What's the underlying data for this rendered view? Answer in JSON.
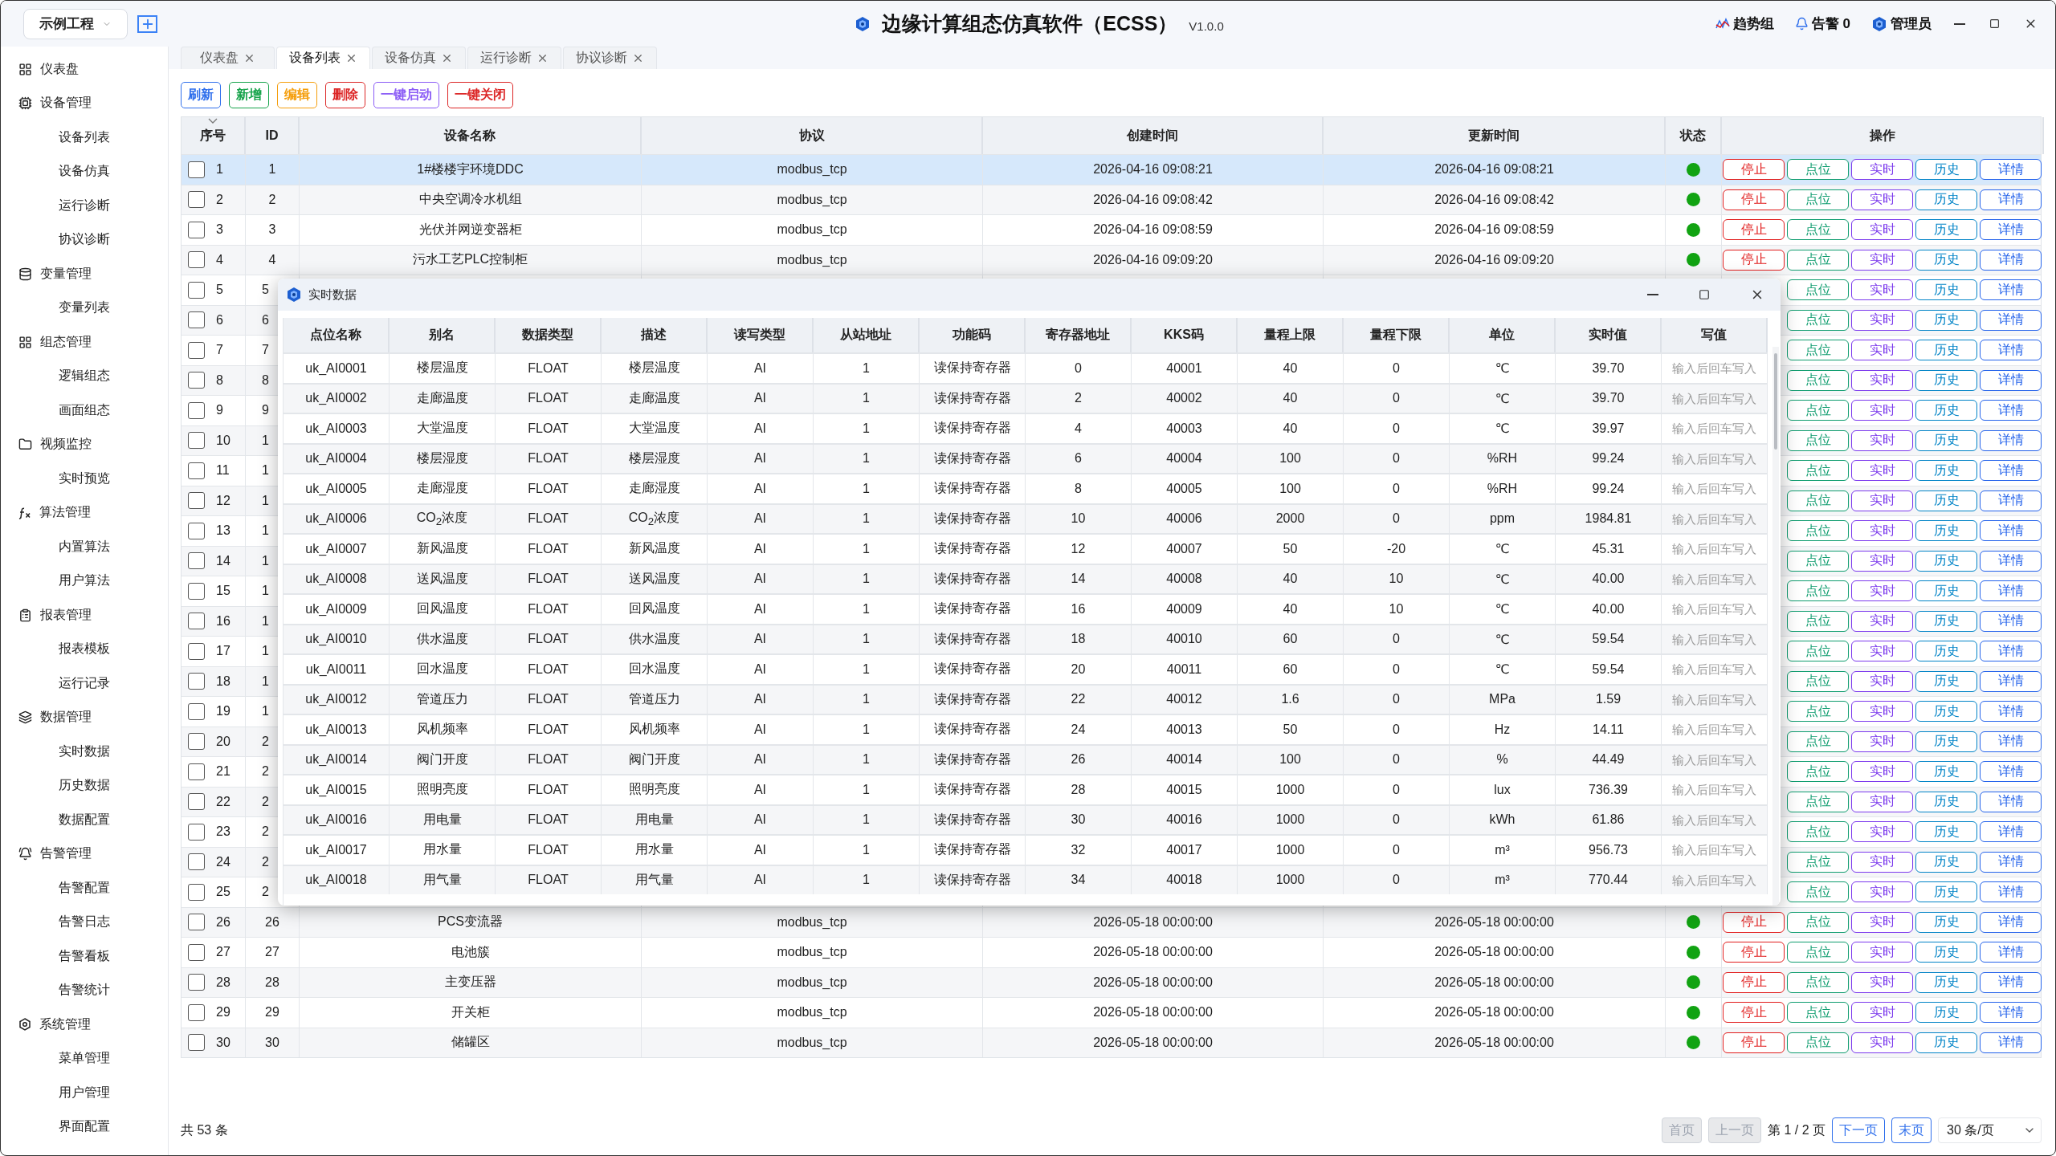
{
  "project_selector": {
    "value": "示例工程"
  },
  "title": "边缘计算组态仿真软件（ECSS）",
  "version": "V1.0.0",
  "header_actions": [
    {
      "kind": "trend",
      "label": "趋势组"
    },
    {
      "kind": "alarm",
      "label": "告警 0"
    },
    {
      "kind": "user",
      "label": "管理员"
    }
  ],
  "sidebar": {
    "groups": [
      {
        "kind": "dashboard",
        "label": "仪表盘"
      },
      {
        "kind": "device",
        "label": "设备管理",
        "children": [
          {
            "label": "设备列表"
          },
          {
            "label": "设备仿真"
          },
          {
            "label": "运行诊断"
          },
          {
            "label": "协议诊断"
          }
        ]
      },
      {
        "kind": "variable",
        "label": "变量管理",
        "children": [
          {
            "label": "变量列表"
          }
        ]
      },
      {
        "kind": "config",
        "label": "组态管理",
        "children": [
          {
            "label": "逻辑组态"
          },
          {
            "label": "画面组态"
          }
        ]
      },
      {
        "kind": "video",
        "label": "视频监控",
        "children": [
          {
            "label": "实时预览"
          }
        ]
      },
      {
        "kind": "algorithm",
        "label": "算法管理",
        "children": [
          {
            "label": "内置算法"
          },
          {
            "label": "用户算法"
          }
        ]
      },
      {
        "kind": "report",
        "label": "报表管理",
        "children": [
          {
            "label": "报表模板"
          },
          {
            "label": "运行记录"
          }
        ]
      },
      {
        "kind": "data",
        "label": "数据管理",
        "children": [
          {
            "label": "实时数据"
          },
          {
            "label": "历史数据"
          },
          {
            "label": "数据配置"
          }
        ]
      },
      {
        "kind": "alarm",
        "label": "告警管理",
        "children": [
          {
            "label": "告警配置"
          },
          {
            "label": "告警日志"
          },
          {
            "label": "告警看板"
          },
          {
            "label": "告警统计"
          }
        ]
      },
      {
        "kind": "system",
        "label": "系统管理",
        "children": [
          {
            "label": "菜单管理"
          },
          {
            "label": "用户管理"
          },
          {
            "label": "界面配置"
          }
        ]
      }
    ]
  },
  "tabs": [
    {
      "label": "仪表盘",
      "selected": false
    },
    {
      "label": "设备列表",
      "selected": true
    },
    {
      "label": "设备仿真",
      "selected": false
    },
    {
      "label": "运行诊断",
      "selected": false
    },
    {
      "label": "协议诊断",
      "selected": false
    }
  ],
  "toolbar": [
    {
      "label": "刷新",
      "color": "#2f6fec"
    },
    {
      "label": "新增",
      "color": "#16a34a"
    },
    {
      "label": "编辑",
      "color": "#f59e0b"
    },
    {
      "label": "删除",
      "color": "#dc2626"
    },
    {
      "label": "一键启动",
      "color": "#8b5cf6"
    },
    {
      "label": "一键关闭",
      "color": "#dc2626"
    }
  ],
  "device_table": {
    "columns": [
      "序号",
      "ID",
      "设备名称",
      "协议",
      "创建时间",
      "更新时间",
      "状态",
      "操作"
    ],
    "rows": [
      {
        "kind": "full",
        "seq": "1",
        "id": "1",
        "name": "1#楼楼宇环境DDC",
        "protocol": "modbus_tcp",
        "created": "2026-04-16 09:08:21",
        "updated": "2026-04-16 09:08:21",
        "online": true,
        "checked": false,
        "selected": true,
        "actions": [
          "停止",
          "点位",
          "实时",
          "历史",
          "详情"
        ]
      },
      {
        "kind": "full",
        "seq": "2",
        "id": "2",
        "name": "中央空调冷水机组",
        "protocol": "modbus_tcp",
        "created": "2026-04-16 09:08:42",
        "updated": "2026-04-16 09:08:42",
        "online": true,
        "checked": false,
        "selected": false,
        "actions": [
          "停止",
          "点位",
          "实时",
          "历史",
          "详情"
        ]
      },
      {
        "kind": "full",
        "seq": "3",
        "id": "3",
        "name": "光伏并网逆变器柜",
        "protocol": "modbus_tcp",
        "created": "2026-04-16 09:08:59",
        "updated": "2026-04-16 09:08:59",
        "online": true,
        "checked": false,
        "selected": false,
        "actions": [
          "停止",
          "点位",
          "实时",
          "历史",
          "详情"
        ]
      },
      {
        "kind": "full",
        "seq": "4",
        "id": "4",
        "name": "污水工艺PLC控制柜",
        "protocol": "modbus_tcp",
        "created": "2026-04-16 09:09:20",
        "updated": "2026-04-16 09:09:20",
        "online": true,
        "checked": false,
        "selected": false,
        "actions": [
          "停止",
          "点位",
          "实时",
          "历史",
          "详情"
        ]
      },
      {
        "kind": "covered",
        "seq": "5",
        "id": "5",
        "checked": false,
        "selected": false,
        "actions": [
          "点位",
          "实时",
          "历史",
          "详情"
        ]
      },
      {
        "kind": "covered",
        "seq": "6",
        "id": "6",
        "checked": false,
        "selected": false,
        "actions": [
          "点位",
          "实时",
          "历史",
          "详情"
        ]
      },
      {
        "kind": "covered",
        "seq": "7",
        "id": "7",
        "checked": false,
        "selected": false,
        "actions": [
          "点位",
          "实时",
          "历史",
          "详情"
        ]
      },
      {
        "kind": "covered",
        "seq": "8",
        "id": "8",
        "checked": false,
        "selected": false,
        "actions": [
          "点位",
          "实时",
          "历史",
          "详情"
        ]
      },
      {
        "kind": "covered",
        "seq": "9",
        "id": "9",
        "checked": false,
        "selected": false,
        "actions": [
          "点位",
          "实时",
          "历史",
          "详情"
        ]
      },
      {
        "kind": "covered",
        "seq": "10",
        "id": "1",
        "checked": false,
        "selected": false,
        "actions": [
          "点位",
          "实时",
          "历史",
          "详情"
        ]
      },
      {
        "kind": "covered",
        "seq": "11",
        "id": "1",
        "checked": false,
        "selected": false,
        "actions": [
          "点位",
          "实时",
          "历史",
          "详情"
        ]
      },
      {
        "kind": "covered",
        "seq": "12",
        "id": "1",
        "checked": false,
        "selected": false,
        "actions": [
          "点位",
          "实时",
          "历史",
          "详情"
        ]
      },
      {
        "kind": "covered",
        "seq": "13",
        "id": "1",
        "checked": false,
        "selected": false,
        "actions": [
          "点位",
          "实时",
          "历史",
          "详情"
        ]
      },
      {
        "kind": "covered",
        "seq": "14",
        "id": "1",
        "checked": false,
        "selected": false,
        "actions": [
          "点位",
          "实时",
          "历史",
          "详情"
        ]
      },
      {
        "kind": "covered",
        "seq": "15",
        "id": "1",
        "checked": false,
        "selected": false,
        "actions": [
          "点位",
          "实时",
          "历史",
          "详情"
        ]
      },
      {
        "kind": "covered",
        "seq": "16",
        "id": "1",
        "checked": false,
        "selected": false,
        "actions": [
          "点位",
          "实时",
          "历史",
          "详情"
        ]
      },
      {
        "kind": "covered",
        "seq": "17",
        "id": "1",
        "checked": false,
        "selected": false,
        "actions": [
          "点位",
          "实时",
          "历史",
          "详情"
        ]
      },
      {
        "kind": "covered",
        "seq": "18",
        "id": "1",
        "checked": false,
        "selected": false,
        "actions": [
          "点位",
          "实时",
          "历史",
          "详情"
        ]
      },
      {
        "kind": "covered",
        "seq": "19",
        "id": "1",
        "checked": false,
        "selected": false,
        "actions": [
          "点位",
          "实时",
          "历史",
          "详情"
        ]
      },
      {
        "kind": "covered",
        "seq": "20",
        "id": "2",
        "checked": false,
        "selected": false,
        "actions": [
          "点位",
          "实时",
          "历史",
          "详情"
        ]
      },
      {
        "kind": "covered",
        "seq": "21",
        "id": "2",
        "checked": false,
        "selected": false,
        "actions": [
          "点位",
          "实时",
          "历史",
          "详情"
        ]
      },
      {
        "kind": "covered",
        "seq": "22",
        "id": "2",
        "checked": false,
        "selected": false,
        "actions": [
          "点位",
          "实时",
          "历史",
          "详情"
        ]
      },
      {
        "kind": "covered",
        "seq": "23",
        "id": "2",
        "checked": false,
        "selected": false,
        "actions": [
          "点位",
          "实时",
          "历史",
          "详情"
        ]
      },
      {
        "kind": "covered",
        "seq": "24",
        "id": "2",
        "checked": false,
        "selected": false,
        "actions": [
          "点位",
          "实时",
          "历史",
          "详情"
        ]
      },
      {
        "kind": "covered",
        "seq": "25",
        "id": "2",
        "checked": false,
        "selected": false,
        "actions": [
          "点位",
          "实时",
          "历史",
          "详情"
        ]
      },
      {
        "kind": "full",
        "seq": "26",
        "id": "26",
        "name": "PCS变流器",
        "protocol": "modbus_tcp",
        "created": "2026-05-18 00:00:00",
        "updated": "2026-05-18 00:00:00",
        "online": true,
        "checked": false,
        "selected": false,
        "actions": [
          "停止",
          "点位",
          "实时",
          "历史",
          "详情"
        ]
      },
      {
        "kind": "full",
        "seq": "27",
        "id": "27",
        "name": "电池簇",
        "protocol": "modbus_tcp",
        "created": "2026-05-18 00:00:00",
        "updated": "2026-05-18 00:00:00",
        "online": true,
        "checked": false,
        "selected": false,
        "actions": [
          "停止",
          "点位",
          "实时",
          "历史",
          "详情"
        ]
      },
      {
        "kind": "full",
        "seq": "28",
        "id": "28",
        "name": "主变压器",
        "protocol": "modbus_tcp",
        "created": "2026-05-18 00:00:00",
        "updated": "2026-05-18 00:00:00",
        "online": true,
        "checked": false,
        "selected": false,
        "actions": [
          "停止",
          "点位",
          "实时",
          "历史",
          "详情"
        ]
      },
      {
        "kind": "full",
        "seq": "29",
        "id": "29",
        "name": "开关柜",
        "protocol": "modbus_tcp",
        "created": "2026-05-18 00:00:00",
        "updated": "2026-05-18 00:00:00",
        "online": true,
        "checked": false,
        "selected": false,
        "actions": [
          "停止",
          "点位",
          "实时",
          "历史",
          "详情"
        ]
      },
      {
        "kind": "full",
        "seq": "30",
        "id": "30",
        "name": "储罐区",
        "protocol": "modbus_tcp",
        "created": "2026-05-18 00:00:00",
        "updated": "2026-05-18 00:00:00",
        "online": true,
        "checked": false,
        "selected": false,
        "actions": [
          "停止",
          "点位",
          "实时",
          "历史",
          "详情"
        ]
      }
    ]
  },
  "pager": {
    "total": "共 53 条",
    "items": [
      {
        "kind": "button",
        "label": "首页",
        "disabled": true
      },
      {
        "kind": "button",
        "label": "上一页",
        "disabled": true
      },
      {
        "kind": "text",
        "label": "第 1 / 2 页"
      },
      {
        "kind": "button",
        "label": "下一页",
        "disabled": false
      },
      {
        "kind": "button",
        "label": "末页",
        "disabled": false
      }
    ],
    "page_size": "30 条/页"
  },
  "dialog": {
    "title": "实时数据",
    "columns": [
      "点位名称",
      "别名",
      "数据类型",
      "描述",
      "读写类型",
      "从站地址",
      "功能码",
      "寄存器地址",
      "KKS码",
      "量程上限",
      "量程下限",
      "单位",
      "实时值",
      "写值"
    ],
    "rows": [
      {
        "cells": [
          "uk_AI0001",
          "楼层温度",
          "FLOAT",
          "楼层温度",
          "AI",
          "1",
          "读保持寄存器",
          "0",
          "40001",
          "40",
          "0",
          "℃",
          "39.70"
        ],
        "write_placeholder": "输入后回车写入"
      },
      {
        "cells": [
          "uk_AI0002",
          "走廊温度",
          "FLOAT",
          "走廊温度",
          "AI",
          "1",
          "读保持寄存器",
          "2",
          "40002",
          "40",
          "0",
          "℃",
          "39.70"
        ],
        "write_placeholder": "输入后回车写入"
      },
      {
        "cells": [
          "uk_AI0003",
          "大堂温度",
          "FLOAT",
          "大堂温度",
          "AI",
          "1",
          "读保持寄存器",
          "4",
          "40003",
          "40",
          "0",
          "℃",
          "39.97"
        ],
        "write_placeholder": "输入后回车写入"
      },
      {
        "cells": [
          "uk_AI0004",
          "楼层湿度",
          "FLOAT",
          "楼层湿度",
          "AI",
          "1",
          "读保持寄存器",
          "6",
          "40004",
          "100",
          "0",
          "%RH",
          "99.24"
        ],
        "write_placeholder": "输入后回车写入"
      },
      {
        "cells": [
          "uk_AI0005",
          "走廊湿度",
          "FLOAT",
          "走廊湿度",
          "AI",
          "1",
          "读保持寄存器",
          "8",
          "40005",
          "100",
          "0",
          "%RH",
          "99.24"
        ],
        "write_placeholder": "输入后回车写入"
      },
      {
        "cells": [
          "uk_AI0006",
          "CO$_{2}$浓度",
          "FLOAT",
          "CO$_{2}$浓度",
          "AI",
          "1",
          "读保持寄存器",
          "10",
          "40006",
          "2000",
          "0",
          "ppm",
          "1984.81"
        ],
        "write_placeholder": "输入后回车写入"
      },
      {
        "cells": [
          "uk_AI0007",
          "新风温度",
          "FLOAT",
          "新风温度",
          "AI",
          "1",
          "读保持寄存器",
          "12",
          "40007",
          "50",
          "-20",
          "℃",
          "45.31"
        ],
        "write_placeholder": "输入后回车写入"
      },
      {
        "cells": [
          "uk_AI0008",
          "送风温度",
          "FLOAT",
          "送风温度",
          "AI",
          "1",
          "读保持寄存器",
          "14",
          "40008",
          "40",
          "10",
          "℃",
          "40.00"
        ],
        "write_placeholder": "输入后回车写入"
      },
      {
        "cells": [
          "uk_AI0009",
          "回风温度",
          "FLOAT",
          "回风温度",
          "AI",
          "1",
          "读保持寄存器",
          "16",
          "40009",
          "40",
          "10",
          "℃",
          "40.00"
        ],
        "write_placeholder": "输入后回车写入"
      },
      {
        "cells": [
          "uk_AI0010",
          "供水温度",
          "FLOAT",
          "供水温度",
          "AI",
          "1",
          "读保持寄存器",
          "18",
          "40010",
          "60",
          "0",
          "℃",
          "59.54"
        ],
        "write_placeholder": "输入后回车写入"
      },
      {
        "cells": [
          "uk_AI0011",
          "回水温度",
          "FLOAT",
          "回水温度",
          "AI",
          "1",
          "读保持寄存器",
          "20",
          "40011",
          "60",
          "0",
          "℃",
          "59.54"
        ],
        "write_placeholder": "输入后回车写入"
      },
      {
        "cells": [
          "uk_AI0012",
          "管道压力",
          "FLOAT",
          "管道压力",
          "AI",
          "1",
          "读保持寄存器",
          "22",
          "40012",
          "1.6",
          "0",
          "MPa",
          "1.59"
        ],
        "write_placeholder": "输入后回车写入"
      },
      {
        "cells": [
          "uk_AI0013",
          "风机频率",
          "FLOAT",
          "风机频率",
          "AI",
          "1",
          "读保持寄存器",
          "24",
          "40013",
          "50",
          "0",
          "Hz",
          "14.11"
        ],
        "write_placeholder": "输入后回车写入"
      },
      {
        "cells": [
          "uk_AI0014",
          "阀门开度",
          "FLOAT",
          "阀门开度",
          "AI",
          "1",
          "读保持寄存器",
          "26",
          "40014",
          "100",
          "0",
          "%",
          "44.49"
        ],
        "write_placeholder": "输入后回车写入"
      },
      {
        "cells": [
          "uk_AI0015",
          "照明亮度",
          "FLOAT",
          "照明亮度",
          "AI",
          "1",
          "读保持寄存器",
          "28",
          "40015",
          "1000",
          "0",
          "lux",
          "736.39"
        ],
        "write_placeholder": "输入后回车写入"
      },
      {
        "cells": [
          "uk_AI0016",
          "用电量",
          "FLOAT",
          "用电量",
          "AI",
          "1",
          "读保持寄存器",
          "30",
          "40016",
          "1000",
          "0",
          "kWh",
          "61.86"
        ],
        "write_placeholder": "输入后回车写入"
      },
      {
        "cells": [
          "uk_AI0017",
          "用水量",
          "FLOAT",
          "用水量",
          "AI",
          "1",
          "读保持寄存器",
          "32",
          "40017",
          "1000",
          "0",
          "m³",
          "956.73"
        ],
        "write_placeholder": "输入后回车写入"
      },
      {
        "cells": [
          "uk_AI0018",
          "用气量",
          "FLOAT",
          "用气量",
          "AI",
          "1",
          "读保持寄存器",
          "34",
          "40018",
          "1000",
          "0",
          "m³",
          "770.44"
        ],
        "write_placeholder": "输入后回车写入"
      }
    ]
  }
}
